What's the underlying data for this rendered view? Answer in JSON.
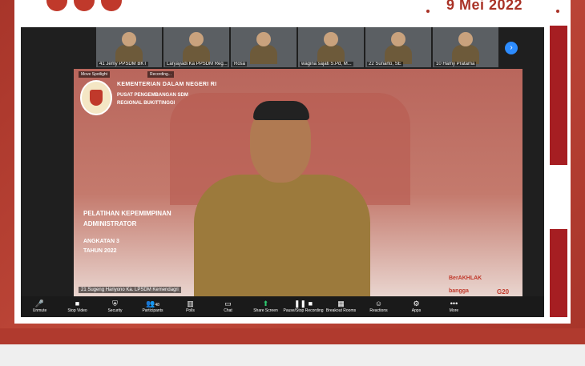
{
  "header": {
    "date": "9 Mei 2022"
  },
  "zoom": {
    "participants": [
      {
        "name": "41 Jemy PPSDM BKT"
      },
      {
        "name": "Laryayadi Ka PPSDM Reg..."
      },
      {
        "name": "Rosa"
      },
      {
        "name": "wagina sajati S.Pd, M..."
      },
      {
        "name": "22 Sunarto, SE"
      },
      {
        "name": "10 Hamy Pratama"
      }
    ],
    "spotlight_label": "Move Spotlight",
    "recording_label": "Recording...",
    "speaker_name": "21 Sugeng Hariyono Ka. LPSDM Kemendagri",
    "banner": {
      "line1": "KEMENTERIAN DALAM NEGERI RI",
      "line2": "PUSAT PENGEMBANGAN SDM",
      "line3": "REGIONAL BUKITTINGGI",
      "line4": "PELATIHAN KEPEMIMPINAN",
      "line5": "ADMINISTRATOR",
      "line6": "ANGKATAN 3",
      "line7": "TAHUN 2022",
      "brand1": "BerAKHLAK",
      "brand2": "bangga",
      "brand3": "G20"
    },
    "toolbar": [
      {
        "label": "Unmute",
        "icon": "microphone-icon"
      },
      {
        "label": "Stop Video",
        "icon": "video-camera-icon"
      },
      {
        "label": "Security",
        "icon": "shield-icon"
      },
      {
        "label": "Participants",
        "icon": "people-icon",
        "count": "48"
      },
      {
        "label": "Polls",
        "icon": "bar-chart-icon"
      },
      {
        "label": "Chat",
        "icon": "chat-bubble-icon"
      },
      {
        "label": "Share Screen",
        "icon": "share-screen-icon"
      },
      {
        "label": "Pause/Stop Recording",
        "icon": "pause-recording-icon"
      },
      {
        "label": "Breakout Rooms",
        "icon": "breakout-rooms-icon"
      },
      {
        "label": "Reactions",
        "icon": "smiley-icon"
      },
      {
        "label": "Apps",
        "icon": "apps-icon"
      },
      {
        "label": "More",
        "icon": "more-icon"
      }
    ]
  },
  "colors": {
    "frame": "#b03a2e",
    "accent": "#a93226",
    "zoom_blue": "#2d8cff",
    "share_green": "#2ecc71"
  }
}
